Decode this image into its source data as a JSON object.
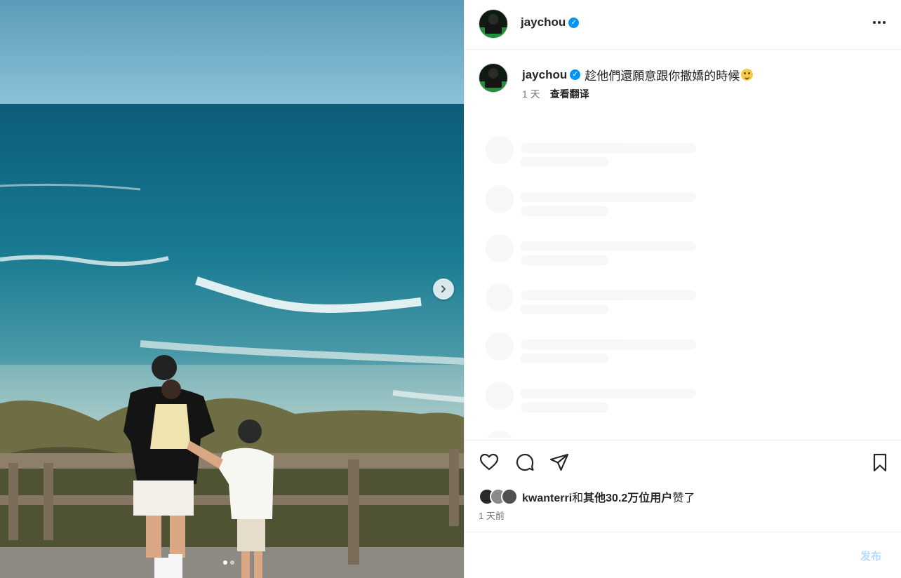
{
  "post": {
    "username": "jaychou",
    "verified": true,
    "caption_text": "趁他們還願意跟你撒嬌的時候",
    "caption_emoji": "relieved-face-emoji",
    "caption_age": "1 天",
    "translate_label": "查看翻译",
    "more_icon": "more-horizontal-icon"
  },
  "media": {
    "next_icon": "chevron-right-icon",
    "slide_count": 2,
    "active_slide": 1
  },
  "actions": {
    "like_icon": "heart-icon",
    "comment_icon": "comment-icon",
    "share_icon": "send-icon",
    "save_icon": "bookmark-icon"
  },
  "likes": {
    "first_liker": "kwanterri",
    "connector": "和",
    "others_text": "其他30.2万位用户",
    "suffix": "赞了"
  },
  "date_label": "1 天前",
  "comment": {
    "placeholder": "",
    "post_label": "发布"
  },
  "colors": {
    "verified_blue": "#0095f6",
    "post_button_disabled": "#b3dbff",
    "secondary_text": "#737373"
  }
}
